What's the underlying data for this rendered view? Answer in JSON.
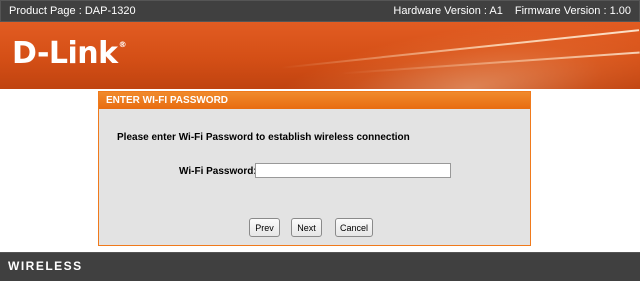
{
  "topbar": {
    "product_page": "Product Page : DAP-1320",
    "hardware_version": "Hardware Version : A1",
    "firmware_version": "Firmware Version : 1.00"
  },
  "banner": {
    "logo_text": "D-Link",
    "logo_mark": "®"
  },
  "panel": {
    "header": "ENTER WI-FI PASSWORD",
    "prompt": "Please enter Wi-Fi Password to establish wireless connection",
    "password_label": "Wi-Fi Password:",
    "password_value": "",
    "buttons": {
      "prev": "Prev",
      "next": "Next",
      "cancel": "Cancel"
    }
  },
  "footer": {
    "label": "WIRELESS"
  },
  "colors": {
    "brand_orange": "#d44f16",
    "header_orange": "#e86c10",
    "dark_bar": "#404040",
    "panel_bg": "#e3e3e3"
  }
}
